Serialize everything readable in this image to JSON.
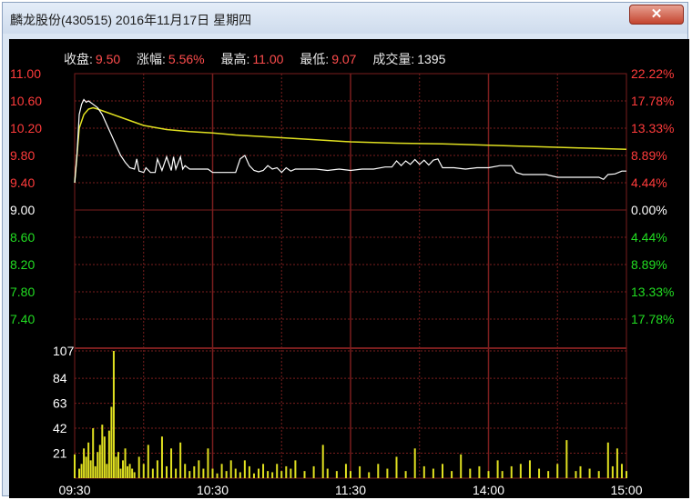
{
  "window": {
    "title": "麟龙股份(430515)  2016年11月17日  星期四",
    "close_label": "✕"
  },
  "info": {
    "close_label": "收盘:",
    "close_value": "9.50",
    "change_label": "涨幅:",
    "change_value": "5.56%",
    "high_label": "最高:",
    "high_value": "11.00",
    "low_label": "最低:",
    "low_value": "9.07",
    "volume_label": "成交量:",
    "volume_value": "1395"
  },
  "colors": {
    "up": "#ff3b3b",
    "down": "#22dd22",
    "neutral": "#ffffff",
    "price_line": "#ffffff",
    "avg_line": "#e0e020",
    "volume_bar": "#e0e020",
    "grid": "#7a1e1e"
  },
  "chart_data": [
    {
      "type": "line",
      "title": "",
      "y_ticks_left": [
        "11.00",
        "10.60",
        "10.20",
        "9.80",
        "9.40",
        "9.00",
        "8.60",
        "8.20",
        "7.80",
        "7.40"
      ],
      "y_ticks_right": [
        "22.22%",
        "17.78%",
        "13.33%",
        "8.89%",
        "4.44%",
        "0.00%",
        "4.44%",
        "8.89%",
        "13.33%",
        "17.78%"
      ],
      "ylim": [
        7.0,
        11.0
      ],
      "x_ticks": [
        "09:30",
        "10:30",
        "11:30",
        "14:00",
        "15:00"
      ],
      "x_range_minutes": [
        0,
        240
      ],
      "series": [
        {
          "x": [
            0,
            1,
            2,
            3,
            4,
            5,
            6,
            8,
            10,
            12,
            14,
            16,
            18,
            20,
            22,
            24,
            26,
            27,
            28,
            30,
            31,
            33,
            35,
            36,
            38,
            40,
            42,
            43,
            44,
            46,
            47,
            48,
            50,
            52,
            54,
            56,
            58,
            60,
            65,
            70,
            71,
            72,
            74,
            76,
            78,
            80,
            82,
            84,
            86,
            88,
            90,
            92,
            94,
            96,
            100,
            105,
            110,
            115,
            120,
            125,
            130,
            135,
            138,
            140,
            142,
            144,
            146,
            148,
            150,
            152,
            154,
            156,
            158,
            160,
            165,
            170,
            175,
            180,
            185,
            190,
            192,
            195,
            200,
            205,
            210,
            215,
            220,
            225,
            228,
            230,
            232,
            235,
            238,
            240
          ],
          "values": [
            9.4,
            9.8,
            10.4,
            10.55,
            10.62,
            10.58,
            10.6,
            10.55,
            10.5,
            10.4,
            10.25,
            10.1,
            9.95,
            9.8,
            9.7,
            9.62,
            9.6,
            9.75,
            9.57,
            9.55,
            9.62,
            9.55,
            9.55,
            9.75,
            9.58,
            9.78,
            9.58,
            9.78,
            9.6,
            9.78,
            9.6,
            9.65,
            9.6,
            9.6,
            9.6,
            9.6,
            9.6,
            9.55,
            9.55,
            9.55,
            9.65,
            9.75,
            9.8,
            9.65,
            9.58,
            9.56,
            9.58,
            9.65,
            9.6,
            9.62,
            9.55,
            9.62,
            9.57,
            9.6,
            9.6,
            9.6,
            9.58,
            9.6,
            9.58,
            9.6,
            9.6,
            9.63,
            9.63,
            9.72,
            9.65,
            9.72,
            9.67,
            9.74,
            9.67,
            9.73,
            9.66,
            9.73,
            9.75,
            9.62,
            9.62,
            9.6,
            9.62,
            9.62,
            9.65,
            9.65,
            9.55,
            9.52,
            9.52,
            9.52,
            9.48,
            9.48,
            9.48,
            9.48,
            9.48,
            9.45,
            9.52,
            9.53,
            9.57,
            9.57
          ]
        },
        {
          "x": [
            0,
            2,
            4,
            6,
            8,
            10,
            15,
            20,
            25,
            30,
            40,
            50,
            60,
            70,
            80,
            90,
            100,
            120,
            140,
            160,
            180,
            200,
            220,
            240
          ],
          "values": [
            9.4,
            10.2,
            10.4,
            10.48,
            10.5,
            10.48,
            10.42,
            10.36,
            10.3,
            10.24,
            10.18,
            10.15,
            10.13,
            10.1,
            10.08,
            10.06,
            10.04,
            10.0,
            9.98,
            9.97,
            9.95,
            9.93,
            9.91,
            9.89
          ]
        }
      ]
    },
    {
      "type": "bar",
      "title": "",
      "y_ticks": [
        "107",
        "84",
        "63",
        "42",
        "21"
      ],
      "ylim": [
        0,
        107
      ],
      "x_range_minutes": [
        0,
        240
      ],
      "x": [
        0,
        2,
        3,
        4,
        5,
        6,
        7,
        8,
        9,
        10,
        11,
        12,
        13,
        14,
        15,
        16,
        17,
        18,
        19,
        20,
        21,
        22,
        23,
        24,
        25,
        26,
        28,
        30,
        32,
        34,
        36,
        38,
        40,
        42,
        44,
        46,
        48,
        50,
        52,
        54,
        56,
        58,
        60,
        62,
        64,
        66,
        68,
        70,
        72,
        74,
        76,
        78,
        80,
        82,
        84,
        86,
        88,
        90,
        92,
        94,
        96,
        100,
        104,
        108,
        110,
        114,
        118,
        120,
        124,
        128,
        132,
        136,
        140,
        144,
        148,
        152,
        156,
        160,
        164,
        168,
        172,
        176,
        180,
        184,
        186,
        190,
        194,
        198,
        202,
        206,
        210,
        214,
        218,
        220,
        224,
        228,
        232,
        234,
        236,
        238,
        240
      ],
      "values": [
        20,
        8,
        12,
        25,
        18,
        30,
        15,
        42,
        10,
        22,
        28,
        45,
        35,
        12,
        40,
        60,
        107,
        18,
        22,
        8,
        15,
        25,
        10,
        12,
        8,
        5,
        18,
        12,
        28,
        8,
        15,
        35,
        10,
        25,
        8,
        30,
        12,
        6,
        10,
        15,
        8,
        25,
        8,
        4,
        12,
        6,
        15,
        8,
        5,
        15,
        10,
        4,
        8,
        12,
        6,
        5,
        12,
        6,
        10,
        8,
        15,
        6,
        10,
        28,
        8,
        6,
        12,
        6,
        10,
        5,
        12,
        8,
        18,
        6,
        25,
        10,
        8,
        12,
        6,
        20,
        8,
        10,
        6,
        15,
        6,
        10,
        12,
        15,
        8,
        6,
        12,
        32,
        6,
        10,
        8,
        6,
        30,
        10,
        25,
        12,
        6
      ]
    }
  ]
}
